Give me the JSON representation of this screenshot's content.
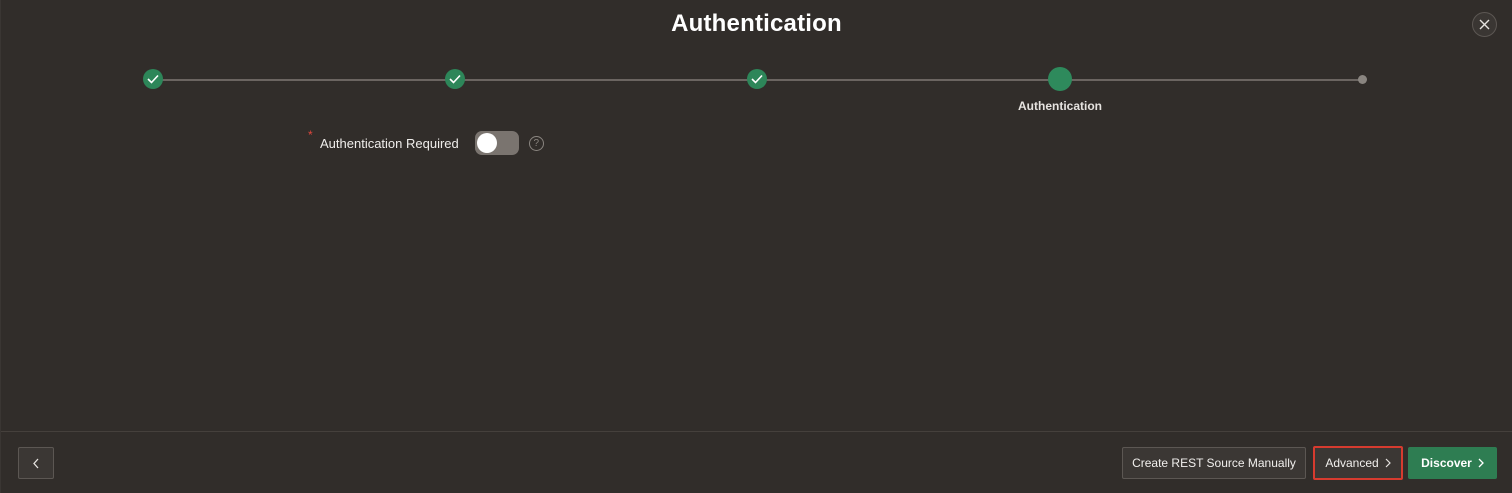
{
  "dialog": {
    "title": "Authentication"
  },
  "train": {
    "steps": [
      {
        "state": "complete",
        "icon": "check-icon"
      },
      {
        "state": "complete",
        "icon": "check-icon"
      },
      {
        "state": "complete",
        "icon": "check-icon"
      },
      {
        "state": "current",
        "label": "Authentication"
      },
      {
        "state": "future"
      }
    ]
  },
  "form": {
    "required_marker": "*",
    "auth_required_label": "Authentication Required",
    "auth_required_value": "off",
    "help_glyph": "?"
  },
  "footer": {
    "create_manual_label": "Create REST Source Manually",
    "advanced_label": "Advanced",
    "discover_label": "Discover"
  },
  "colors": {
    "background": "#312d2a",
    "accent_green": "#2e7d52",
    "highlight_red": "#d63b2f"
  }
}
